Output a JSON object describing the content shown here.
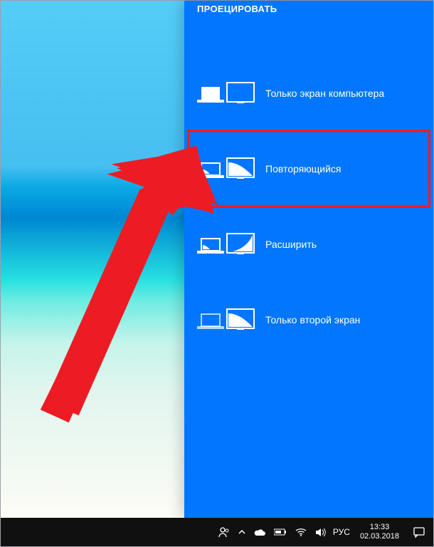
{
  "panel": {
    "title": "ПРОЕЦИРОВАТЬ",
    "options": [
      {
        "label": "Только экран компьютера"
      },
      {
        "label": "Повторяющийся"
      },
      {
        "label": "Расширить"
      },
      {
        "label": "Только второй экран"
      }
    ],
    "highlight_index": "1"
  },
  "taskbar": {
    "lang": "РУС",
    "time": "13:33",
    "date": "02.03.2018"
  },
  "colors": {
    "panel_bg": "#0276ff",
    "highlight": "#ed1c24",
    "taskbar_bg": "#101010"
  }
}
